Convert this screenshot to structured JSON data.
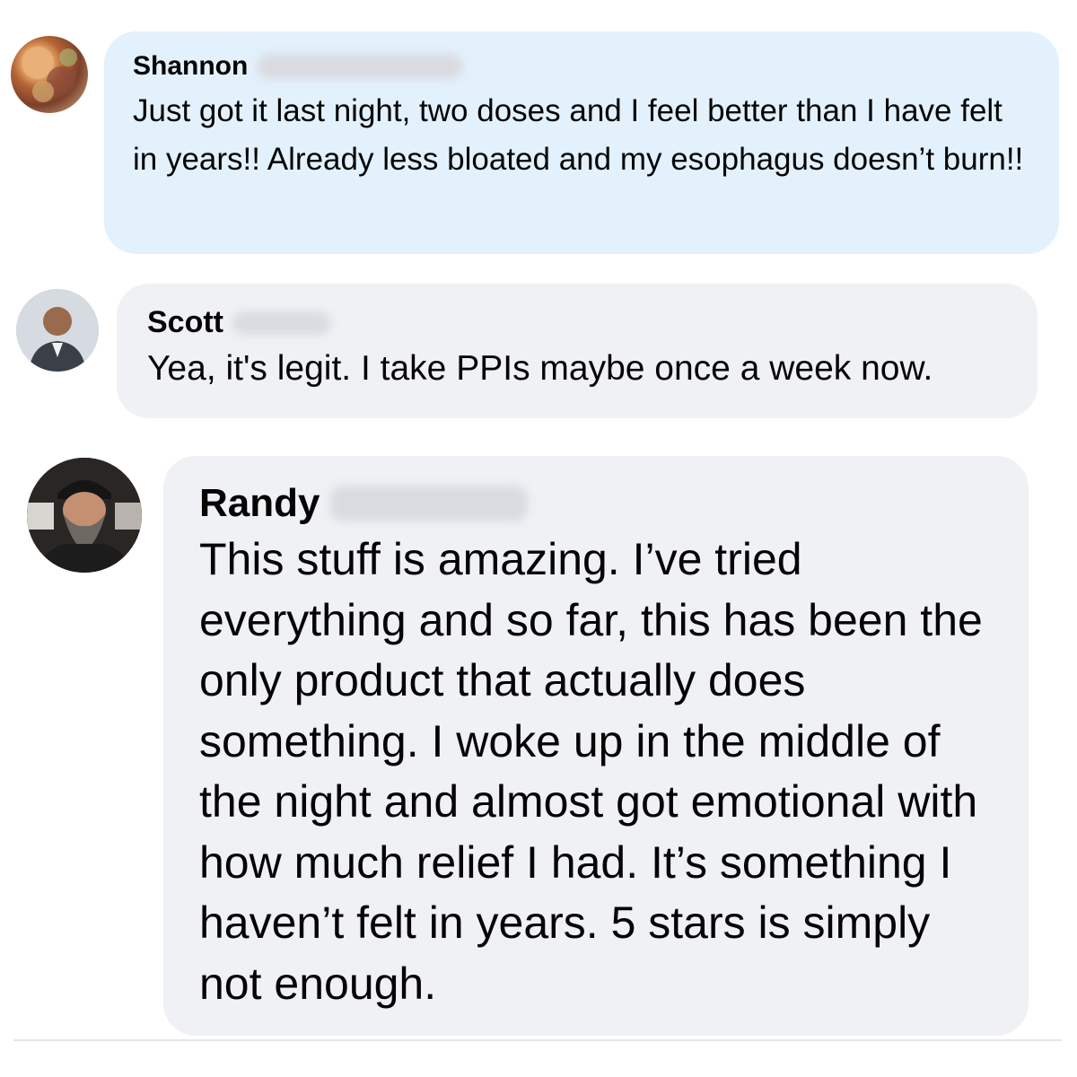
{
  "comments": [
    {
      "author": "Shannon",
      "text": "Just got it last night, two doses and I feel better than I have felt in years!! Already less bloated and my esophagus doesn’t burn!!",
      "bubble_color": "#e3f1fd"
    },
    {
      "author": "Scott",
      "text": "Yea, it's legit. I take PPIs maybe once a week now.",
      "bubble_color": "#f0f1f4"
    },
    {
      "author": "Randy",
      "text": "This stuff is amazing. I’ve tried everything and so far, this has been the only product that actually does something. I woke up in the middle of the night and almost got emotional with how much relief I had. It’s something I haven’t felt in years. 5 stars is simply not enough.",
      "bubble_color": "#f0f1f4"
    }
  ]
}
